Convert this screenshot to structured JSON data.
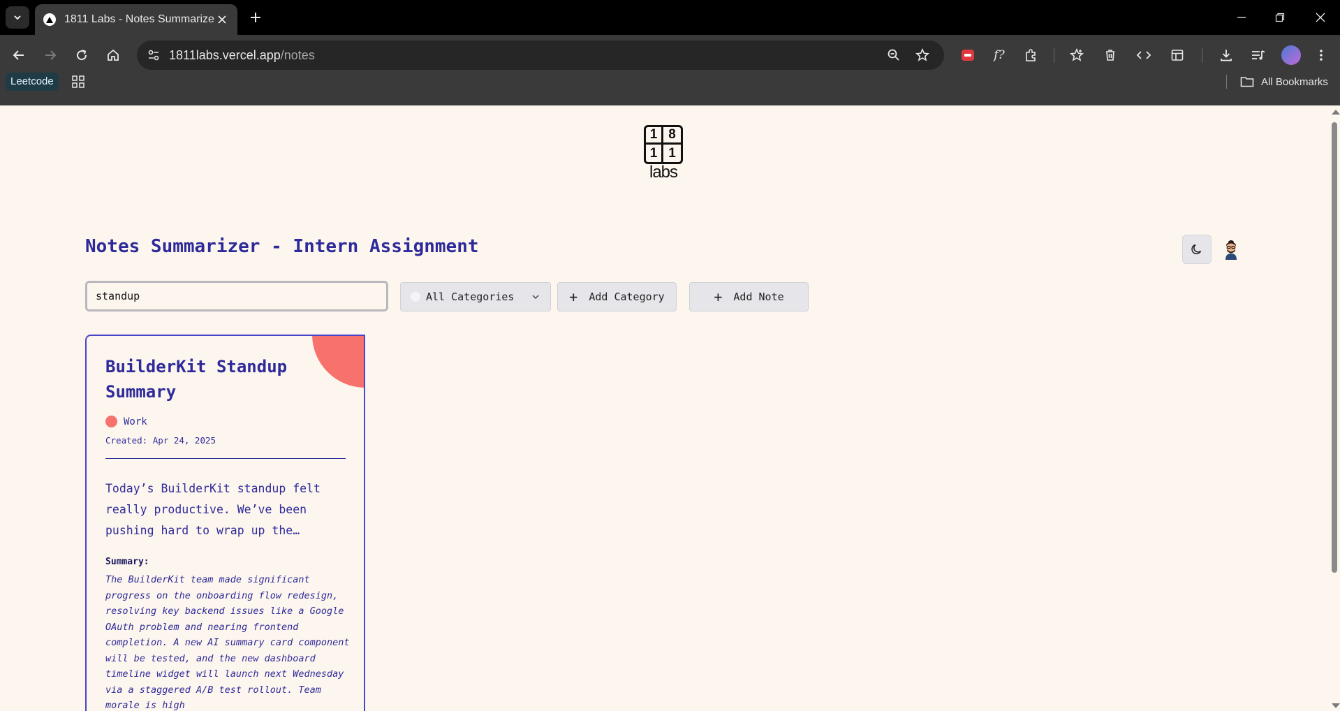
{
  "browser": {
    "tab_title": "1811 Labs - Notes Summarizer",
    "url_host": "1811labs.vercel.app",
    "url_path": "/notes",
    "bookmarks": [
      {
        "label": "Leetcode"
      }
    ],
    "all_bookmarks_label": "All Bookmarks"
  },
  "logo": {
    "digits": [
      "1",
      "8",
      "1",
      "1"
    ],
    "text": "labs"
  },
  "header": {
    "title": "Notes Summarizer - Intern Assignment"
  },
  "controls": {
    "search_value": "standup",
    "category_select": "All Categories",
    "add_category_label": "Add Category",
    "add_note_label": "Add Note"
  },
  "notes": [
    {
      "title": "BuilderKit Standup Summary",
      "category": "Work",
      "category_color": "#f7716d",
      "created": "Created: Apr 24, 2025",
      "body": "Today’s BuilderKit standup felt really productive. We’ve been pushing hard to wrap up the…",
      "summary_label": "Summary:",
      "summary": "The BuilderKit team made significant progress on the onboarding flow redesign, resolving key backend issues like a Google OAuth problem and nearing frontend completion. A new AI summary card component will be tested, and the new dashboard timeline widget will launch next Wednesday via a staggered A/B test rollout. Team morale is high"
    }
  ],
  "colors": {
    "accent": "#2e2a9a",
    "card_border": "#4a44c6",
    "page_bg": "#fdf6ee",
    "work_category": "#f7716d"
  },
  "icons": [
    "tab-list-icon",
    "close-icon",
    "plus-icon",
    "minimize-icon",
    "restore-icon",
    "back-icon",
    "forward-icon",
    "reload-icon",
    "home-icon",
    "site-info-icon",
    "zoom-icon",
    "star-icon",
    "extension-icon",
    "download-icon",
    "folder-icon",
    "moon-icon",
    "chevron-down-icon"
  ]
}
